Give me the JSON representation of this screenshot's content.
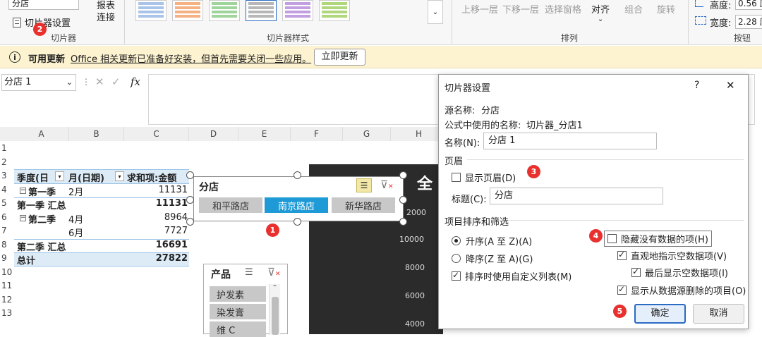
{
  "ribbon": {
    "slicer_name_value": "分店",
    "slicer_settings_label": "切片器设置",
    "slicer_group_label": "切片器",
    "report_connect_label": "报表\n连接",
    "styles_group_label": "切片器样式",
    "arrange": {
      "bring_forward": "上移一层",
      "send_backward": "下移一层",
      "selection_pane": "选择窗格",
      "align": "对齐",
      "group": "组合",
      "rotate": "旋转",
      "group_label": "排列"
    },
    "buttons": {
      "height_label": "高度:",
      "height_value": "0.56 厘",
      "width_label": "宽度:",
      "width_value": "2.28 厘",
      "group_label": "按钮"
    },
    "style_swatch_colors": [
      "#a9c4e8",
      "#f4b183",
      "#9fd59b",
      "#b7b7b7",
      "#c29fe0",
      "#b0d77c"
    ]
  },
  "infobar": {
    "title": "可用更新",
    "message": "Office 相关更新已准备好安装，但首先需要关闭一些应用。",
    "button": "立即更新"
  },
  "formula_bar": {
    "name_box": "分店 1",
    "fx": "fx"
  },
  "sheet": {
    "columns": [
      "A",
      "B",
      "C",
      "D",
      "E",
      "F",
      "G",
      "H"
    ],
    "rows": [
      "1",
      "2",
      "3",
      "4",
      "5",
      "6",
      "7",
      "8",
      "9",
      "10",
      "11",
      "12",
      "13"
    ],
    "pivot": {
      "header": [
        "季度(日",
        "月(日期)",
        "求和项:金额"
      ],
      "r4": [
        "第一季",
        "2月",
        "11131"
      ],
      "r5": [
        "第一季 汇总",
        "11131"
      ],
      "r6": [
        "第二季",
        "4月",
        "8964"
      ],
      "r7": [
        "6月",
        "7727"
      ],
      "r8": [
        "第二季 汇总",
        "16691"
      ],
      "r9": [
        "总计",
        "27822"
      ]
    },
    "chart_title_partial": "全",
    "chart_axis": [
      "2000",
      "10000",
      "8000",
      "6000",
      "4000"
    ]
  },
  "slicer_branch": {
    "title": "分店",
    "items": [
      "和平路店",
      "南京路店",
      "新华路店"
    ],
    "selected": "南京路店"
  },
  "slicer_product": {
    "title": "产品",
    "items": [
      "护发素",
      "染发膏",
      "维 C"
    ]
  },
  "dialog": {
    "title": "切片器设置",
    "help": "?",
    "close": "✕",
    "source_name_label": "源名称:",
    "source_name_value": "分店",
    "formula_name_label": "公式中使用的名称:",
    "formula_name_value": "切片器_分店1",
    "name_label": "名称(N):",
    "name_value": "分店 1",
    "header_section": "页眉",
    "show_header_label": "显示页眉(D)",
    "caption_label": "标题(C):",
    "caption_value": "分店",
    "sort_section": "项目排序和筛选",
    "sort_asc": "升序(A 至 Z)(A)",
    "sort_desc": "降序(Z 至 A)(G)",
    "custom_list": "排序时使用自定义列表(M)",
    "hide_no_data": "隐藏没有数据的项(H)",
    "visual_indicate": "直观地指示空数据项(V)",
    "show_last": "最后显示空数据项(I)",
    "show_deleted": "显示从数据源删除的项目(O)",
    "ok": "确定",
    "cancel": "取消"
  },
  "badges": [
    "1",
    "2",
    "3",
    "4",
    "5"
  ]
}
